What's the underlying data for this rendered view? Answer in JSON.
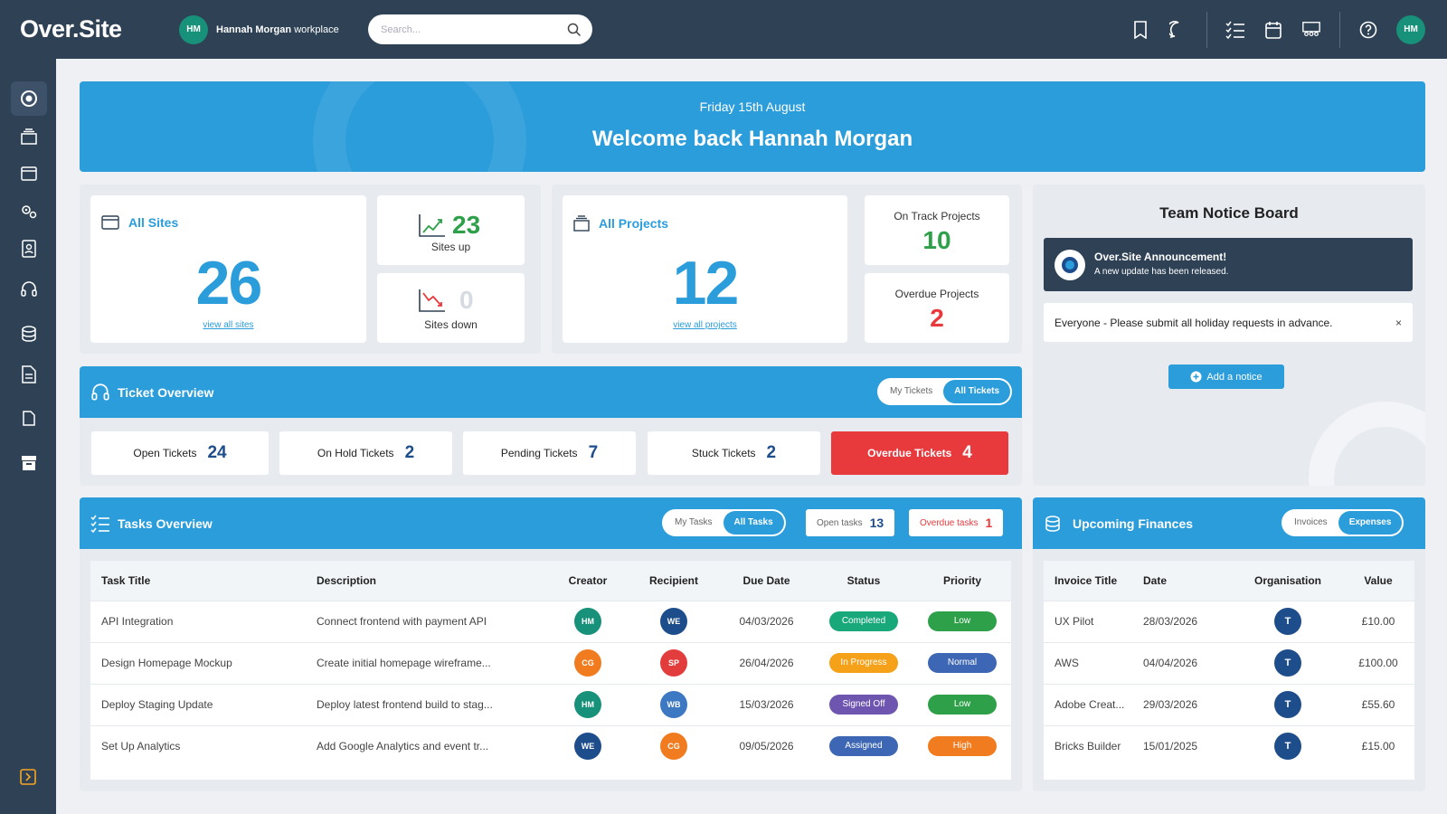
{
  "topbar": {
    "logo": "Over.Site",
    "workspace_initials": "HM",
    "workspace_user": "Hannah Morgan",
    "workspace_suffix": "workplace",
    "search_placeholder": "Search...",
    "user_initials": "HM"
  },
  "banner": {
    "date": "Friday 15th August",
    "welcome": "Welcome back Hannah Morgan"
  },
  "sites": {
    "title": "All Sites",
    "count": "26",
    "link": "view all sites",
    "up_count": "23",
    "up_label": "Sites up",
    "down_count": "0",
    "down_label": "Sites down"
  },
  "projects": {
    "title": "All Projects",
    "count": "12",
    "link": "view all projects",
    "on_track_label": "On Track Projects",
    "on_track_count": "10",
    "overdue_label": "Overdue Projects",
    "overdue_count": "2"
  },
  "tickets": {
    "title": "Ticket Overview",
    "toggle_mine": "My Tickets",
    "toggle_all": "All Tickets",
    "cards": [
      {
        "label": "Open Tickets",
        "value": "24"
      },
      {
        "label": "On Hold Tickets",
        "value": "2"
      },
      {
        "label": "Pending Tickets",
        "value": "7"
      },
      {
        "label": "Stuck Tickets",
        "value": "2"
      },
      {
        "label": "Overdue Tickets",
        "value": "4"
      }
    ]
  },
  "notice_board": {
    "title": "Team Notice Board",
    "announce_title": "Over.Site Announcement!",
    "announce_text": "A new update has been released.",
    "notice": "Everyone - Please submit all holiday requests in advance.",
    "close": "×",
    "add_label": "Add a notice"
  },
  "tasks": {
    "title": "Tasks Overview",
    "toggle_mine": "My Tasks",
    "toggle_all": "All Tasks",
    "open_label": "Open tasks",
    "open_count": "13",
    "overdue_label": "Overdue tasks",
    "overdue_count": "1",
    "headers": [
      "Task Title",
      "Description",
      "Creator",
      "Recipient",
      "Due Date",
      "Status",
      "Priority"
    ],
    "rows": [
      {
        "title": "API Integration",
        "desc": "Connect frontend with payment API",
        "creator": "HM",
        "recipient": "WE",
        "due": "04/03/2026",
        "status": "Completed",
        "priority": "Low"
      },
      {
        "title": "Design Homepage Mockup",
        "desc": "Create initial homepage wireframe...",
        "creator": "CG",
        "recipient": "SP",
        "due": "26/04/2026",
        "status": "In Progress",
        "priority": "Normal"
      },
      {
        "title": "Deploy Staging Update",
        "desc": "Deploy latest frontend build to stag...",
        "creator": "HM",
        "recipient": "WB",
        "due": "15/03/2026",
        "status": "Signed Off",
        "priority": "Low"
      },
      {
        "title": "Set Up Analytics",
        "desc": "Add Google Analytics and event tr...",
        "creator": "WE",
        "recipient": "CG",
        "due": "09/05/2026",
        "status": "Assigned",
        "priority": "High"
      }
    ]
  },
  "finances": {
    "title": "Upcoming Finances",
    "toggle_invoices": "Invoices",
    "toggle_expenses": "Expenses",
    "headers": [
      "Invoice Title",
      "Date",
      "Organisation",
      "Value"
    ],
    "rows": [
      {
        "title": "UX Pilot",
        "date": "28/03/2026",
        "org": "T",
        "value": "£10.00"
      },
      {
        "title": "AWS",
        "date": "04/04/2026",
        "org": "T",
        "value": "£100.00"
      },
      {
        "title": "Adobe Creat...",
        "date": "29/03/2026",
        "org": "T",
        "value": "£55.60"
      },
      {
        "title": "Bricks Builder",
        "date": "15/01/2025",
        "org": "T",
        "value": "£15.00"
      }
    ]
  },
  "colors": {
    "primary": "#2b9ddb",
    "navy": "#2e4155",
    "green": "#2fa04a",
    "red": "#e8393c"
  }
}
